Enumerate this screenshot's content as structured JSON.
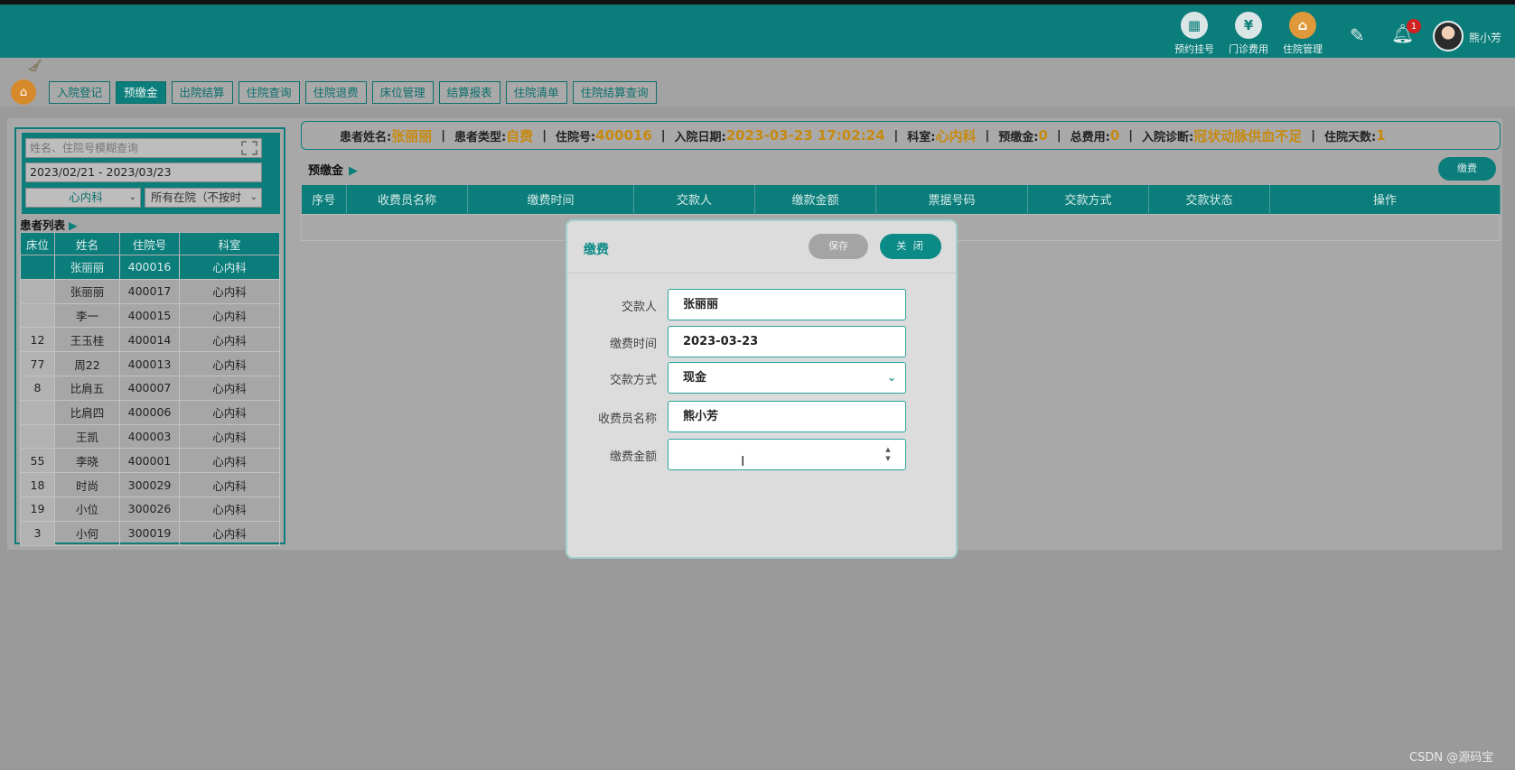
{
  "topnav": {
    "items": [
      {
        "label": "预约挂号",
        "icon": "calendar-icon",
        "glyph": "▦"
      },
      {
        "label": "门诊费用",
        "icon": "yen-icon",
        "glyph": "¥"
      },
      {
        "label": "住院管理",
        "icon": "bed-icon",
        "glyph": "⌂"
      }
    ],
    "notification_count": "1",
    "username": "熊小芳"
  },
  "menu": {
    "items": [
      "入院登记",
      "预缴金",
      "出院结算",
      "住院查询",
      "住院退费",
      "床位管理",
      "结算报表",
      "住院清单",
      "住院结算查询"
    ],
    "active": "预缴金"
  },
  "left": {
    "search_placeholder": "姓名、住院号模糊查询",
    "date_range": "2023/02/21 - 2023/03/23",
    "dept_select": "心内科",
    "status_select": "所有在院（不按时",
    "list_title": "患者列表",
    "columns": [
      "床位",
      "姓名",
      "住院号",
      "科室"
    ],
    "rows": [
      [
        "",
        "张丽丽",
        "400016",
        "心内科"
      ],
      [
        "",
        "张丽丽",
        "400017",
        "心内科"
      ],
      [
        "",
        "李一",
        "400015",
        "心内科"
      ],
      [
        "12",
        "王玉桂",
        "400014",
        "心内科"
      ],
      [
        "77",
        "周22",
        "400013",
        "心内科"
      ],
      [
        "8",
        "比肩五",
        "400007",
        "心内科"
      ],
      [
        "",
        "比肩四",
        "400006",
        "心内科"
      ],
      [
        "",
        "王凯",
        "400003",
        "心内科"
      ],
      [
        "55",
        "李晓",
        "400001",
        "心内科"
      ],
      [
        "18",
        "时尚",
        "300029",
        "心内科"
      ],
      [
        "19",
        "小位",
        "300026",
        "心内科"
      ],
      [
        "3",
        "小何",
        "300019",
        "心内科"
      ]
    ]
  },
  "patient_info": {
    "name_label": "患者姓名:",
    "name": "张丽丽",
    "type_label": "患者类型:",
    "type": "自费",
    "inpatient_no_label": "住院号:",
    "inpatient_no": "400016",
    "admit_date_label": "入院日期:",
    "admit_date": "2023-03-23 17:02:24",
    "dept_label": "科室:",
    "dept": "心内科",
    "deposit_label": "预缴金:",
    "deposit": "0",
    "total_label": "总费用:",
    "total": "0",
    "diagnosis_label": "入院诊断:",
    "diagnosis": "冠状动脉供血不足",
    "days_label": "住院天数:",
    "days": "1"
  },
  "deposit_section": {
    "title": "预缴金",
    "pay_button": "缴费",
    "columns": [
      "序号",
      "收费员名称",
      "缴费时间",
      "交款人",
      "缴款金额",
      "票据号码",
      "交款方式",
      "交款状态",
      "操作"
    ]
  },
  "modal": {
    "title": "缴费",
    "save_label": "保存",
    "close_label": "关 闭",
    "fields": {
      "payer_label": "交款人",
      "payer": "张丽丽",
      "time_label": "缴费时间",
      "time": "2023-03-23",
      "method_label": "交款方式",
      "method": "现金",
      "cashier_label": "收费员名称",
      "cashier": "熊小芳",
      "amount_label": "缴费金额",
      "amount": ""
    }
  },
  "watermark": "CSDN @源码宝"
}
